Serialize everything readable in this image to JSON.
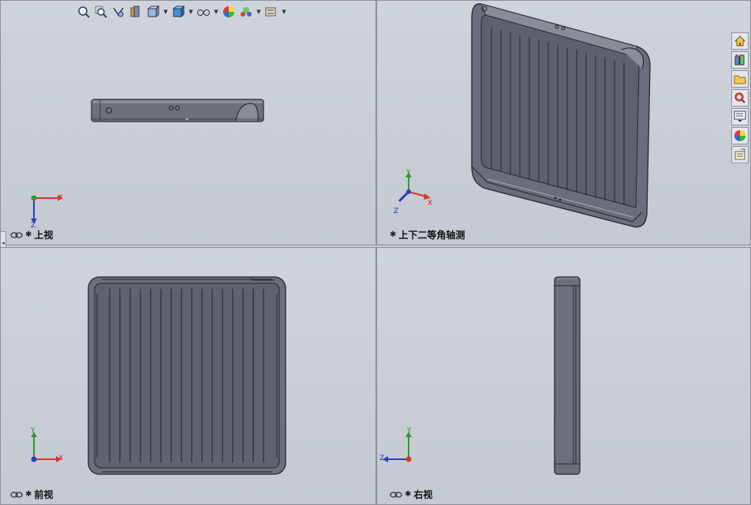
{
  "views": {
    "top": {
      "label": "上视"
    },
    "iso": {
      "label": "上下二等角轴测"
    },
    "front": {
      "label": "前视"
    },
    "right": {
      "label": "右视"
    }
  },
  "triad_axes": {
    "top": [
      "X",
      "Z"
    ],
    "iso": [
      "Y",
      "X",
      "Z"
    ],
    "front": [
      "Y",
      "X"
    ],
    "right": [
      "Y",
      "Z"
    ]
  },
  "toolbar_icons": [
    "zoom-to-fit-icon",
    "zoom-to-area-icon",
    "previous-view-icon",
    "section-view-icon",
    "view-orientation-icon",
    "display-style-icon",
    "hide-show-items-icon",
    "edit-appearance-icon",
    "apply-scene-icon",
    "view-settings-icon"
  ],
  "taskpane_icons": [
    "solidworks-resources-icon",
    "design-library-icon",
    "file-explorer-icon",
    "search-icon",
    "view-palette-icon",
    "appearances-icon",
    "custom-properties-icon"
  ],
  "colors": {
    "background": "#c9ced6",
    "part": "#6e7180",
    "part_dark": "#2d2f38",
    "axis_x": "#d23a2a",
    "axis_y": "#2f9a2f",
    "axis_z": "#2a3fb8"
  }
}
